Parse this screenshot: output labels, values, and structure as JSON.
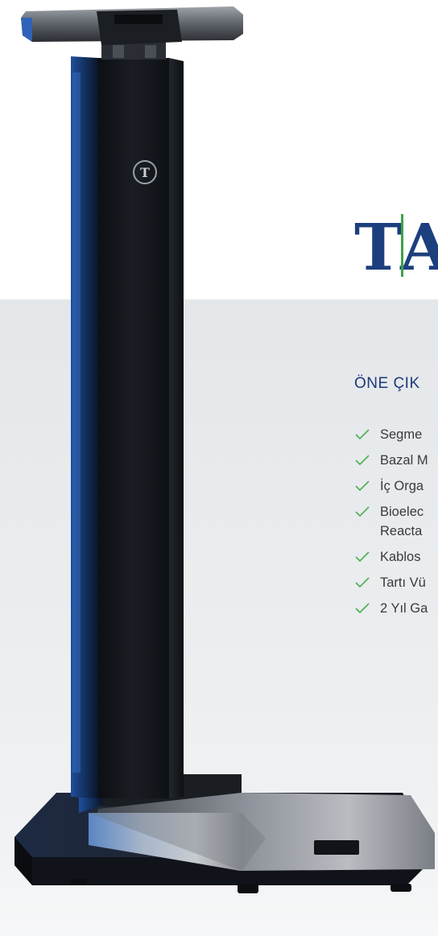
{
  "brand": {
    "name": "TA",
    "accent_color": "#3ea247",
    "primary_color": "#1c3f7e"
  },
  "product": {
    "logo_mark": "T"
  },
  "features": {
    "title": "ÖNE ÇIK",
    "items": [
      {
        "label": "Segme"
      },
      {
        "label": "Bazal M"
      },
      {
        "label": "İç Orga"
      },
      {
        "label": "Bioelec",
        "label2": "Reacta"
      },
      {
        "label": "Kablos"
      },
      {
        "label": "Tartı Vü"
      },
      {
        "label": "2 Yıl Ga"
      }
    ],
    "check_color": "#4caf50"
  }
}
